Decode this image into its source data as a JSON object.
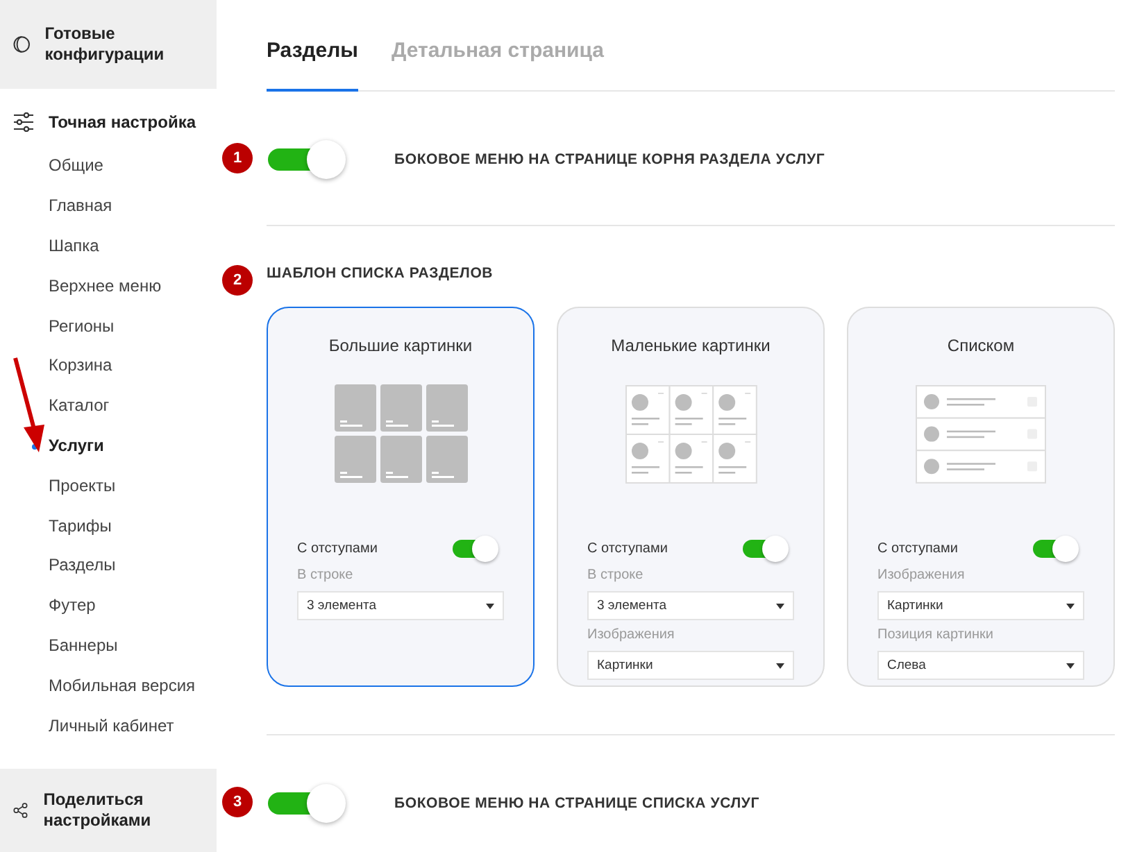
{
  "sidebar": {
    "top_block": {
      "label": "Готовые конфигурации"
    },
    "group": {
      "label": "Точная настройка",
      "items": [
        {
          "label": "Общие",
          "selected": false
        },
        {
          "label": "Главная",
          "selected": false
        },
        {
          "label": "Шапка",
          "selected": false
        },
        {
          "label": "Верхнее меню",
          "selected": false
        },
        {
          "label": "Регионы",
          "selected": false
        },
        {
          "label": "Корзина",
          "selected": false
        },
        {
          "label": "Каталог",
          "selected": false
        },
        {
          "label": "Услуги",
          "selected": true
        },
        {
          "label": "Проекты",
          "selected": false
        },
        {
          "label": "Тарифы",
          "selected": false
        },
        {
          "label": "Разделы",
          "selected": false
        },
        {
          "label": "Футер",
          "selected": false
        },
        {
          "label": "Баннеры",
          "selected": false
        },
        {
          "label": "Мобильная версия",
          "selected": false
        },
        {
          "label": "Личный кабинет",
          "selected": false
        }
      ]
    },
    "bottom_block": {
      "label": "Поделиться настройками"
    }
  },
  "tabs": [
    {
      "label": "Разделы",
      "selected": true
    },
    {
      "label": "Детальная страница",
      "selected": false
    }
  ],
  "sections": [
    {
      "kind": "toggle",
      "badge": "1",
      "label": "БОКОВОЕ МЕНЮ НА СТРАНИЦЕ КОРНЯ РАЗДЕЛА УСЛУГ",
      "on": true
    },
    {
      "kind": "templates",
      "badge": "2",
      "label": "ШАБЛОН СПИСКА РАЗДЕЛОВ",
      "cards": [
        {
          "title": "Большие картинки",
          "kind": "tiles",
          "selected": true,
          "switch": {
            "label": "С отступами",
            "on": true
          },
          "selects": [
            {
              "label": "В строке",
              "value": "3 элемента"
            }
          ]
        },
        {
          "title": "Маленькие картинки",
          "kind": "small",
          "selected": false,
          "switch": {
            "label": "С отступами",
            "on": true
          },
          "selects": [
            {
              "label": "В строке",
              "value": "3 элемента"
            },
            {
              "label": "Изображения",
              "value": "Картинки"
            }
          ]
        },
        {
          "title": "Списком",
          "kind": "list",
          "selected": false,
          "switch": {
            "label": "С отступами",
            "on": true
          },
          "selects": [
            {
              "label": "Изображения",
              "value": "Картинки"
            },
            {
              "label": "Позиция картинки",
              "value": "Слева"
            }
          ]
        }
      ]
    },
    {
      "kind": "toggle",
      "badge": "3",
      "label": "БОКОВОЕ МЕНЮ НА СТРАНИЦЕ СПИСКА УСЛУГ",
      "on": true
    }
  ]
}
